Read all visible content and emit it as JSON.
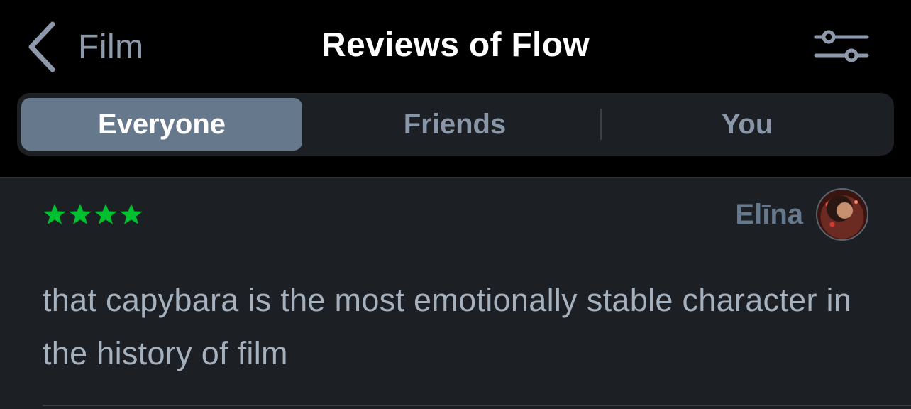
{
  "header": {
    "back_label": "Film",
    "title": "Reviews of Flow",
    "filter_icon": "sliders-icon"
  },
  "tabs": [
    {
      "label": "Everyone",
      "selected": true
    },
    {
      "label": "Friends",
      "selected": false
    },
    {
      "label": "You",
      "selected": false
    }
  ],
  "review": {
    "rating": 4,
    "rating_max": 4,
    "star_color": "#00c030",
    "reviewer": "Elīna",
    "text": "that capybara is the most emotionally stable character in the history of film"
  },
  "colors": {
    "header_bg": "#000000",
    "content_bg": "#1c1f24",
    "selected_tab_bg": "#66788b",
    "muted_text": "#8a97a8"
  }
}
